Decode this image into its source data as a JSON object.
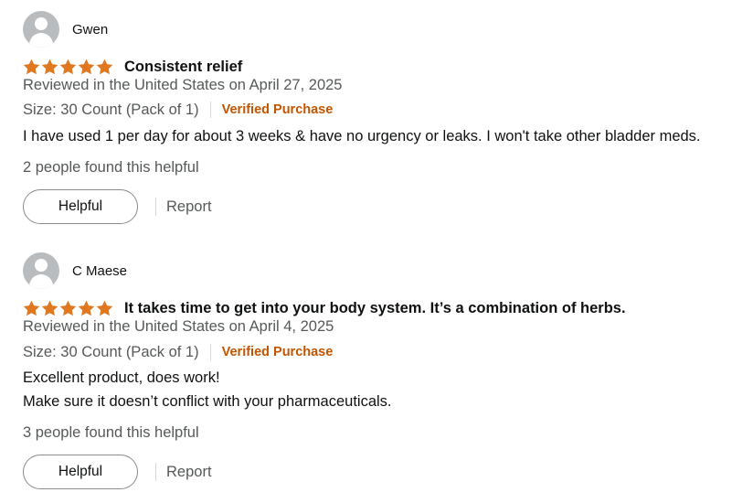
{
  "reviews": [
    {
      "name": "Gwen",
      "avatar_icon": "default-avatar-icon",
      "stars": 5,
      "title": "Consistent relief",
      "reviewed_line": "Reviewed in the United States on April 27, 2025",
      "size": "Size: 30 Count (Pack of 1)",
      "verified": "Verified Purchase",
      "body": [
        "I have used 1 per day for about 3 weeks & have no urgency or leaks. I won't take other bladder meds."
      ],
      "helpful_count": "2 people found this helpful",
      "helpful_label": "Helpful",
      "report_label": "Report"
    },
    {
      "name": "C Maese",
      "avatar_icon": "default-avatar-icon",
      "stars": 5,
      "title": "It takes time to get into your body system. It’s a combination of herbs.",
      "reviewed_line": "Reviewed in the United States on April 4, 2025",
      "size": "Size: 30 Count (Pack of 1)",
      "verified": "Verified Purchase",
      "body": [
        "Excellent product, does work!",
        "Make sure it doesn’t conflict with your pharmaceuticals."
      ],
      "helpful_count": "3 people found this helpful",
      "helpful_label": "Helpful",
      "report_label": "Report"
    }
  ],
  "colors": {
    "star": "#de7921",
    "verified": "#c45500",
    "muted": "#565959",
    "text": "#0f1111"
  }
}
